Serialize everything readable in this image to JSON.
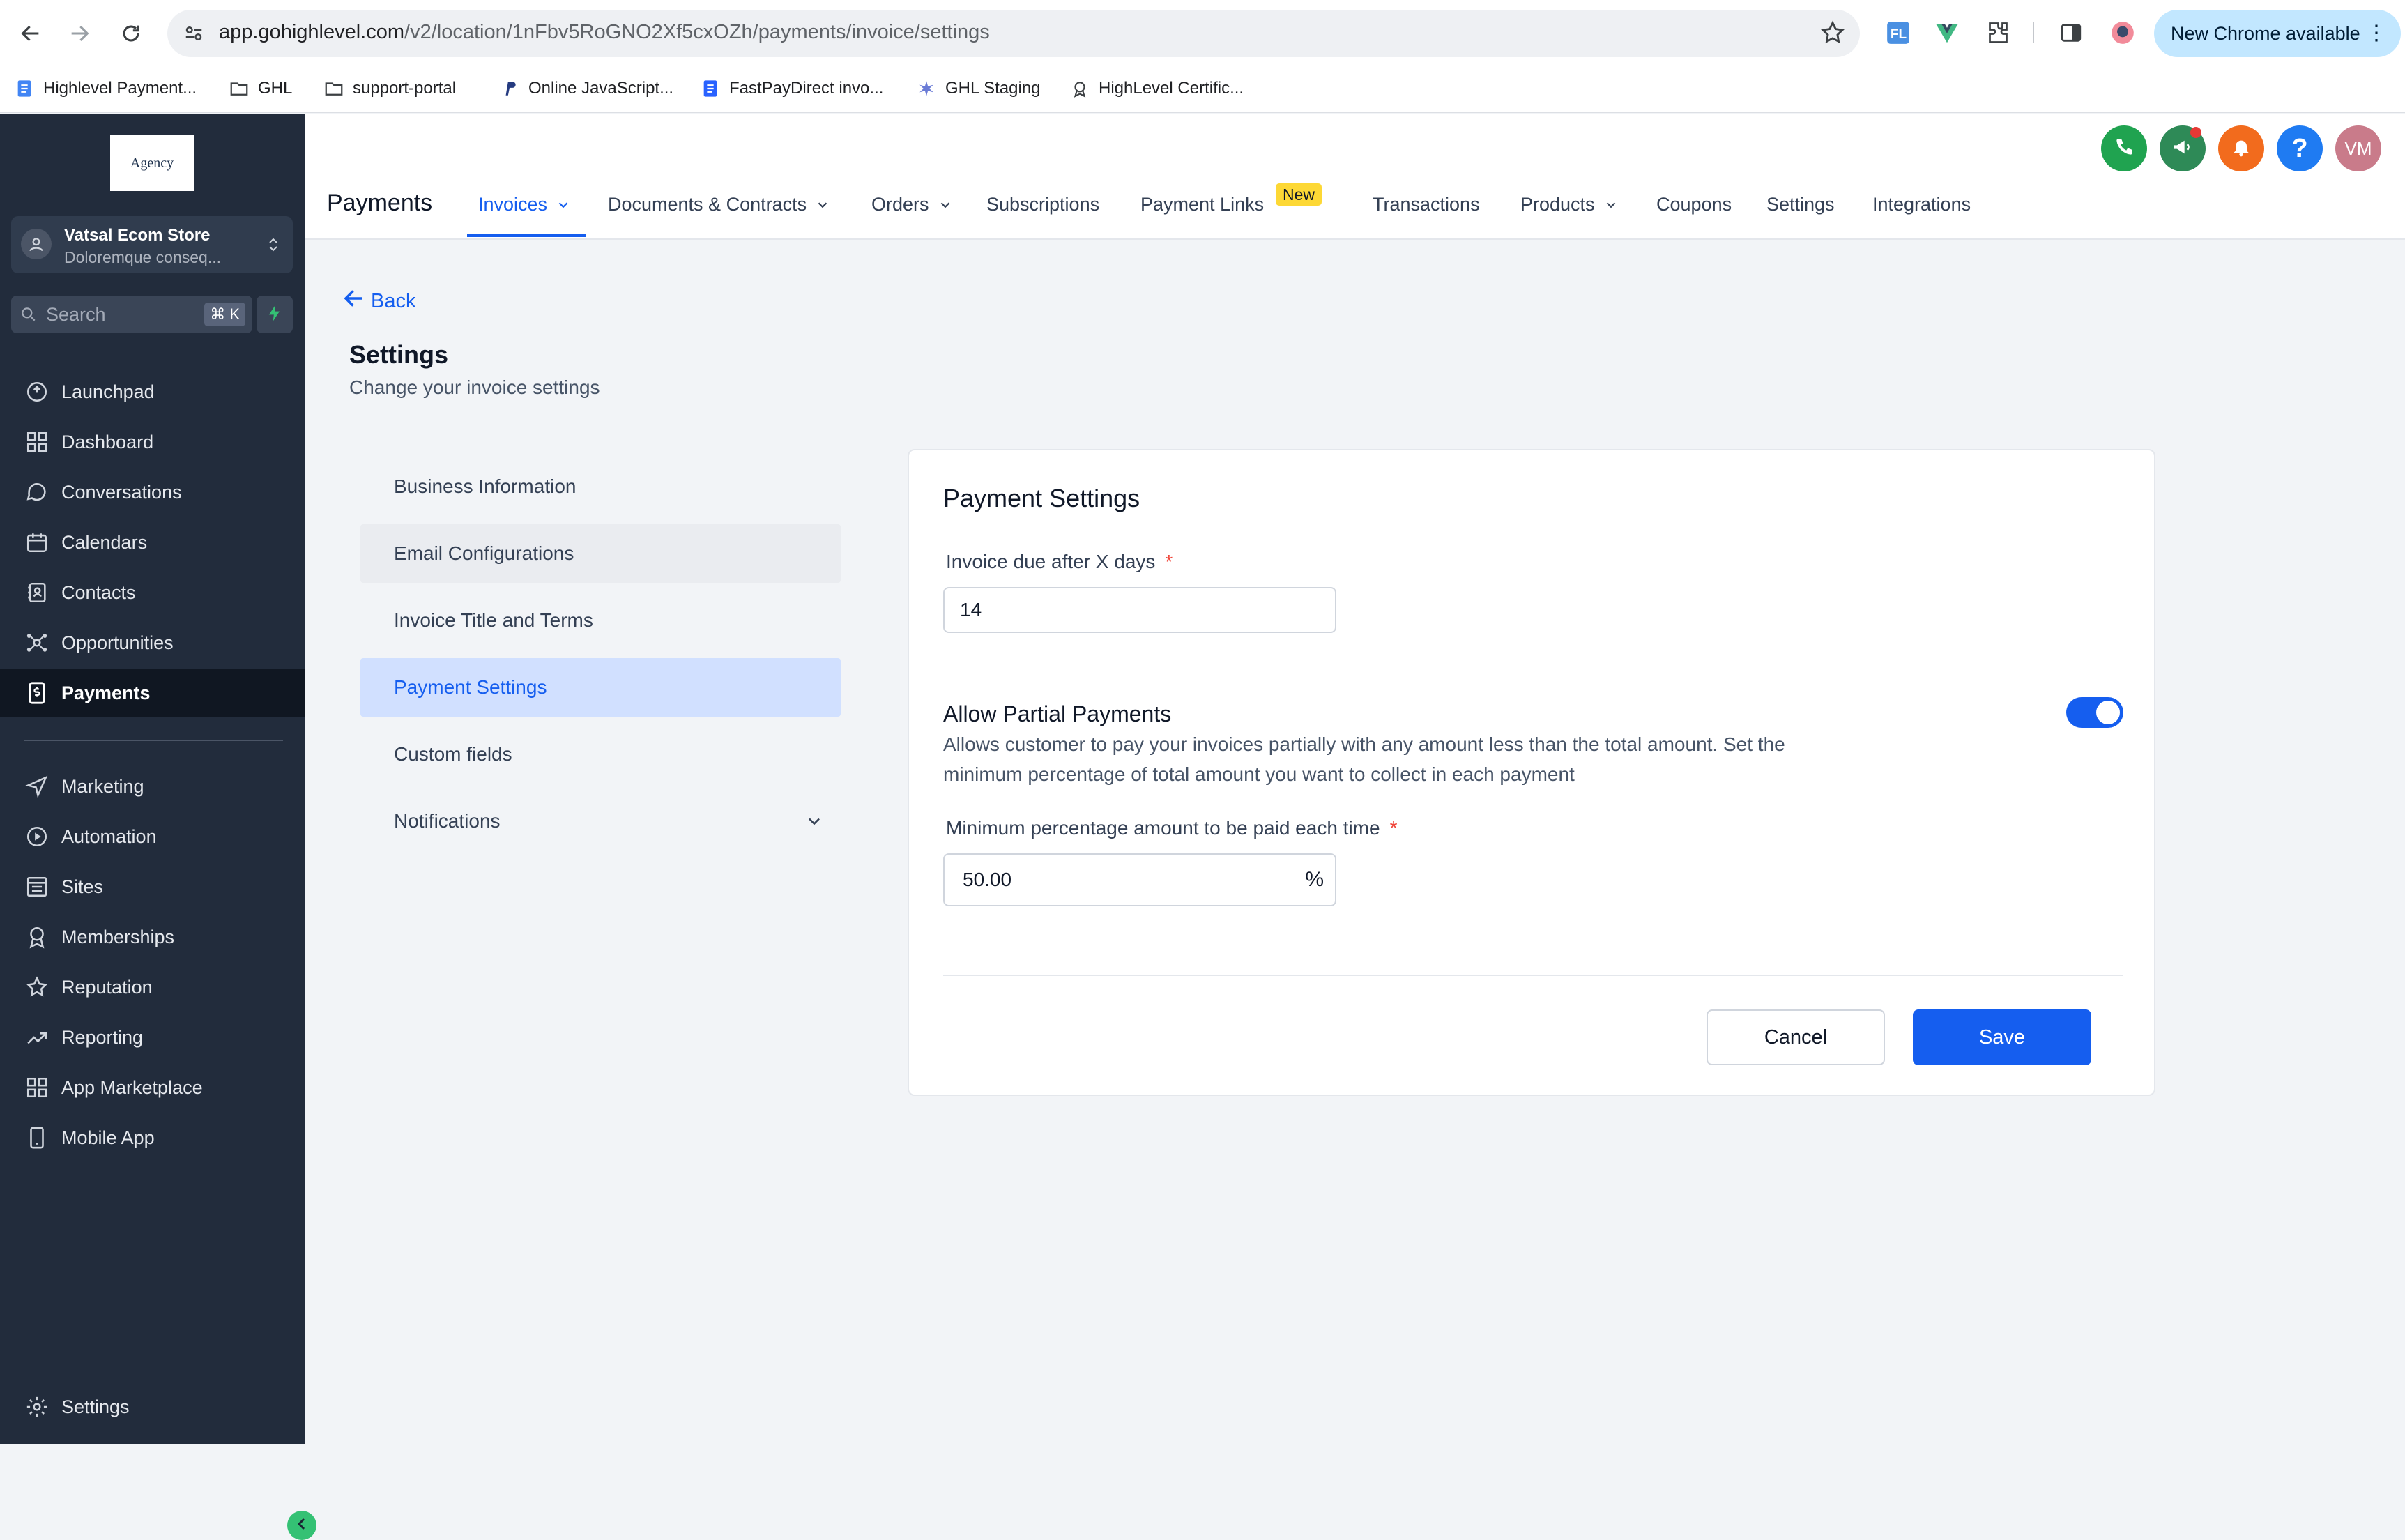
{
  "browser": {
    "url_host": "app.gohighlevel.com",
    "url_path": "/v2/location/1nFbv5RoGNO2Xf5cxOZh/payments/invoice/settings",
    "new_chrome_label": "New Chrome available",
    "bookmarks": [
      {
        "label": "Highlevel Payment...",
        "icon": "doc-icon"
      },
      {
        "label": "GHL",
        "icon": "folder-icon"
      },
      {
        "label": "support-portal",
        "icon": "folder-icon"
      },
      {
        "label": "Online JavaScript...",
        "icon": "paypal-icon"
      },
      {
        "label": "FastPayDirect invo...",
        "icon": "doc-icon"
      },
      {
        "label": "GHL Staging",
        "icon": "star-burst-icon"
      },
      {
        "label": "HighLevel Certific...",
        "icon": "badge-icon"
      }
    ]
  },
  "sidebar": {
    "logo_text": "Agency",
    "account_name": "Vatsal Ecom Store",
    "account_sub": "Doloremque conseq...",
    "search_placeholder": "Search",
    "search_shortcut": "⌘ K",
    "items": [
      {
        "label": "Launchpad",
        "icon": "rocket-icon"
      },
      {
        "label": "Dashboard",
        "icon": "grid-icon"
      },
      {
        "label": "Conversations",
        "icon": "chat-icon"
      },
      {
        "label": "Calendars",
        "icon": "calendar-icon"
      },
      {
        "label": "Contacts",
        "icon": "contacts-icon"
      },
      {
        "label": "Opportunities",
        "icon": "opportunities-icon"
      },
      {
        "label": "Payments",
        "icon": "payments-icon",
        "active": true
      }
    ],
    "items2": [
      {
        "label": "Marketing",
        "icon": "send-icon"
      },
      {
        "label": "Automation",
        "icon": "automation-icon"
      },
      {
        "label": "Sites",
        "icon": "sites-icon"
      },
      {
        "label": "Memberships",
        "icon": "membership-icon"
      },
      {
        "label": "Reputation",
        "icon": "star-icon"
      },
      {
        "label": "Reporting",
        "icon": "chart-line-icon"
      },
      {
        "label": "App Marketplace",
        "icon": "apps-icon"
      },
      {
        "label": "Mobile App",
        "icon": "mobile-icon"
      }
    ],
    "settings_label": "Settings"
  },
  "topbar": {
    "title": "Payments",
    "user_initials": "VM",
    "tabs": [
      {
        "label": "Invoices",
        "dropdown": true,
        "active": true
      },
      {
        "label": "Documents & Contracts",
        "dropdown": true
      },
      {
        "label": "Orders",
        "dropdown": true
      },
      {
        "label": "Subscriptions"
      },
      {
        "label": "Payment Links"
      },
      {
        "label": "Transactions"
      },
      {
        "label": "Products",
        "dropdown": true
      },
      {
        "label": "Coupons"
      },
      {
        "label": "Settings"
      },
      {
        "label": "Integrations"
      }
    ],
    "new_badge": "New"
  },
  "page": {
    "back_label": "Back",
    "title": "Settings",
    "subtitle": "Change your invoice settings",
    "settings_nav": [
      "Business Information",
      "Email Configurations",
      "Invoice Title and Terms",
      "Payment Settings",
      "Custom fields",
      "Notifications"
    ],
    "selected_nav": "Payment Settings"
  },
  "card": {
    "title": "Payment Settings",
    "due_label": "Invoice due after X days",
    "due_value": "14",
    "partial_title": "Allow Partial Payments",
    "partial_desc": "Allows customer to pay your invoices partially with any amount less than the total amount. Set the minimum percentage of total amount you want to collect in each payment",
    "partial_enabled": true,
    "min_label": "Minimum percentage amount to be paid each time",
    "min_value": "50.00",
    "min_unit": "%",
    "required_mark": "*",
    "cancel_label": "Cancel",
    "save_label": "Save"
  },
  "colors": {
    "primary": "#155eef",
    "sidebar_bg": "#222c3c",
    "phone_green": "#20a350",
    "megaphone_green": "#2e8a57",
    "bell_orange": "#f26b1d",
    "help_blue": "#1f7bf2",
    "avatar_pink": "#c97b8a"
  }
}
